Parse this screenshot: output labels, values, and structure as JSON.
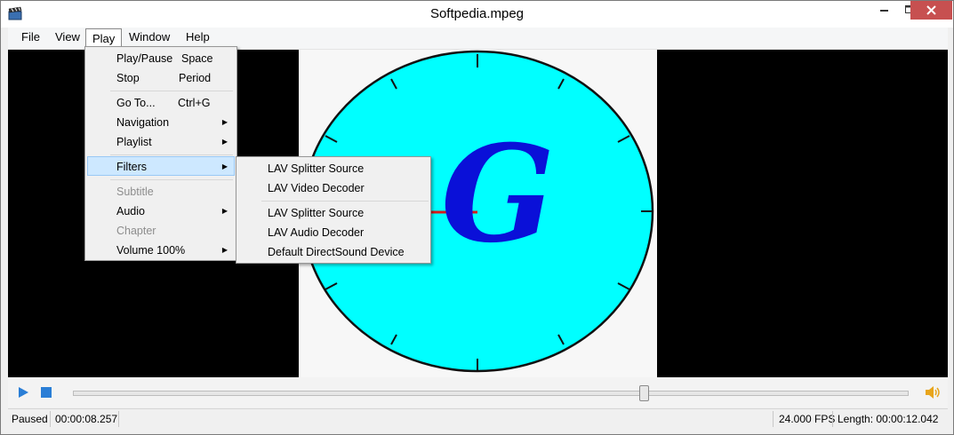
{
  "window": {
    "title": "Softpedia.mpeg"
  },
  "menubar": [
    {
      "label": "File"
    },
    {
      "label": "View"
    },
    {
      "label": "Play"
    },
    {
      "label": "Window"
    },
    {
      "label": "Help"
    }
  ],
  "play_menu": {
    "play_pause": {
      "label": "Play/Pause",
      "shortcut": "Space"
    },
    "stop": {
      "label": "Stop",
      "shortcut": "Period"
    },
    "goto": {
      "label": "Go To...",
      "shortcut": "Ctrl+G"
    },
    "navigation": {
      "label": "Navigation"
    },
    "playlist": {
      "label": "Playlist"
    },
    "filters": {
      "label": "Filters"
    },
    "subtitle": {
      "label": "Subtitle"
    },
    "audio": {
      "label": "Audio"
    },
    "chapter": {
      "label": "Chapter"
    },
    "volume": {
      "label": "Volume 100%"
    }
  },
  "filters_submenu": {
    "items": [
      "LAV Splitter Source",
      "LAV Video Decoder",
      "LAV Splitter Source",
      "LAV Audio Decoder",
      "Default DirectSound Device"
    ]
  },
  "video": {
    "letter": "G"
  },
  "controls": {
    "seek_progress": 0.683
  },
  "status": {
    "state": "Paused",
    "position": "00:00:08.257",
    "fps": "24.000 FPS",
    "length": "Length: 00:00:12.042"
  },
  "colors": {
    "clock_face": "#00ffff",
    "letter": "#0a10d8",
    "hand": "#d81a1a",
    "close_button": "#c75050",
    "accent": "#2a7ed6"
  }
}
